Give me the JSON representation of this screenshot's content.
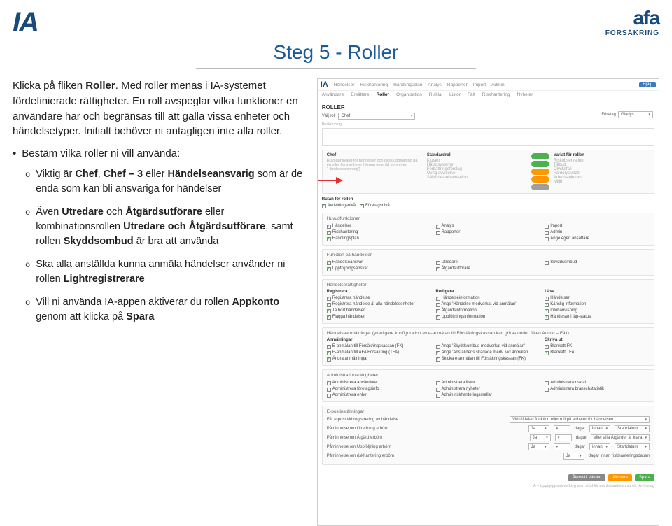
{
  "header": {
    "logo_left": "IA",
    "logo_right": "afa",
    "logo_right_sub": "FÖRSÄKRING",
    "title": "Steg 5 - Roller"
  },
  "intro": {
    "p1_a": "Klicka på fliken ",
    "p1_b": "Roller",
    "p1_c": ". Med roller menas i IA-systemet fördefinierade rättigheter. En roll avspeglar vilka funktioner en användare har och begränsas till att gälla vissa enheter och händelsetyper. Initialt behöver ni antagligen inte alla roller.",
    "bullet": "Bestäm vilka roller ni vill använda:",
    "items": [
      "Viktig är <b>Chef</b>, <b>Chef – 3</b> eller <b>Händelseansvarig</b> som är de enda som kan bli ansvariga för händelser",
      "Även <b>Utredare</b> och <b>Åtgärdsutförare</b> eller kombinationsrollen <b>Utredare och Åtgärds­utförare</b>, samt rollen <b>Skyddsombud</b> är bra att använda",
      "Ska alla anställda kunna anmäla händelser använder ni rollen <b>Lightregistrerare</b>",
      "Vill ni använda IA-appen aktiverar du rollen <b>Appkonto</b> genom att klicka på <b>Spara</b>"
    ]
  },
  "screenshot": {
    "brand": "IA",
    "menu": [
      "Händelser",
      "Riskhantering",
      "Handlingsplan",
      "Analys",
      "Rapporter",
      "Import",
      "Admin"
    ],
    "help": "Hjälp",
    "tabs": [
      "Användare",
      "Ersättare",
      "Roller",
      "Organisation",
      "Risklal",
      "Listor",
      "Fält",
      "Riskhantering",
      "Nyheter"
    ],
    "tabs_active": "Roller",
    "page_heading": "ROLLER",
    "company_label": "Företag",
    "company_value": "Gladys",
    "select_label": "Välj roll",
    "select_value": "Chef",
    "desc_label": "Beskrivning",
    "role_block": {
      "title": "Chef",
      "text": "Huvudansvarig för händelser och dess uppföljning på en eller flera enheter (denna innehåll som even 'Händelseansvarig')",
      "mid_head": "Standardroll",
      "mid_items": [
        "Kluster",
        "Hälsosystemet",
        "Förbättringsförslag",
        "Övrig avvikelse",
        "Säkerhetsobservation"
      ],
      "right_head": "Variat för rollen",
      "right_items": [
        "Riskobservation",
        "Tillbud",
        "Olycksfall",
        "Färdolycksfall",
        "Arbetssjukdom",
        "Miljö"
      ]
    },
    "rutan": {
      "label": "Rutan för rollen",
      "items": [
        "Avdelningsnivå",
        "Företagsnivå"
      ]
    },
    "huvud": {
      "title": "Huvudfunktioner",
      "c1": [
        "Händelser",
        "Riskhantering",
        "Handlingsplan"
      ],
      "c2": [
        "Analys",
        "Rapporter"
      ],
      "c3": [
        "Import",
        "Admin",
        "Ange egen ansättare"
      ]
    },
    "funktion": {
      "title": "Funktion på händelser",
      "c1": [
        "Händelseansvar",
        "Uppföljningsansvar"
      ],
      "c2": [
        "Utredare",
        "Åtgärdsutförare"
      ],
      "c3": [
        "Skyddsombud"
      ]
    },
    "ratt": {
      "title": "Händelserättigheter",
      "g1_head": "Registrera",
      "g1": [
        "Registrera händelse",
        "Registrera händelse åt alla händelseenheter",
        "Ta bort händelser",
        "Flagga händelser"
      ],
      "g2_head": "Redigera",
      "g2": [
        "Händelseinformation",
        "Ange 'Händelse medverkat vid anmälan'",
        "Åtgärdsinformation",
        "Uppföljningsinformation"
      ],
      "g3_head": "Läsa",
      "g3": [
        "Händelser",
        "Känslig information",
        "Infohänvisning",
        "Händelser i läp-status"
      ]
    },
    "anm": {
      "title": "Händelseanmälningar (ytterligare konfiguration av e-anmälan till Försäkringskassan kan göras under fliken Admin – Fält)",
      "c1_head": "Anmälningar",
      "c1": [
        "E-anmälan till Försäkringskassan (FK)",
        "E-anmälan till AFA Försäkring (TFA)",
        "Ändra anmälningar"
      ],
      "c2": [
        "Ange 'Skyddsombud medverkat vid anmälan'",
        "Ange 'Anställdens skadade medv. vid anmälan'",
        "Skicka e-anmälan till Försäkringskassan (FK)"
      ],
      "c3_head": "Skriva ut",
      "c3": [
        "Blankett FK",
        "Blankett TFA"
      ]
    },
    "admin": {
      "title": "Administrationsrättigheter",
      "c1": [
        "Administrera användare",
        "Administrera företagsinfo",
        "Administrera enhet"
      ],
      "c2": [
        "Administrera listor",
        "Administrera nyheter",
        "Admin riskhanteringsmallar"
      ],
      "c3": [
        "Administrera risklal",
        "Administrera branschstatistik"
      ]
    },
    "epost": {
      "title": "E-postinställningar",
      "rows": [
        {
          "label": "Får e-post vid registrering av händelse",
          "sel": "Vid tilldelad funktion eller roll på enheter för händelsen"
        },
        {
          "label": "Påminnelse om Utredning erbörn",
          "sel": "Ja",
          "days": "",
          "t": "dagar",
          "after": "innan",
          "s": "Startdatum"
        },
        {
          "label": "Påminnelse om Åtgärd erbörn",
          "sel": "Ja",
          "days": "",
          "t": "dagar",
          "after": "efter alla Åtgärder är klara"
        },
        {
          "label": "Påminnelse om Uppföljning erbörn",
          "sel": "Ja",
          "days": "",
          "t": "dagar",
          "after": "innan",
          "s": "Startdatum"
        },
        {
          "label": "Påminnelse om riskhantering erbörn",
          "sel": "Ja",
          "t": "dagar innan riskhanteringsdatum"
        }
      ]
    },
    "buttons": [
      "Återställ värden",
      "Aktivera",
      "Spara"
    ],
    "footnote": "IA – Uppbyggnadsverktyg som stöd för administratören av ett IA-företag"
  }
}
